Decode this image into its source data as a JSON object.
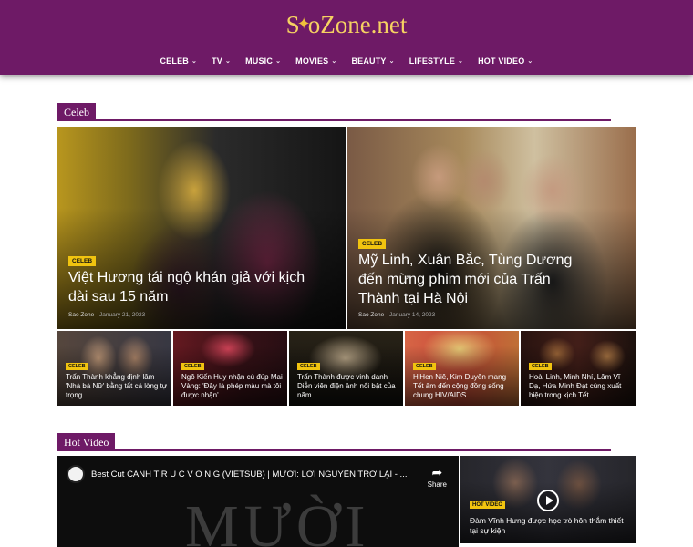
{
  "site": {
    "logo_part1": "S",
    "logo_part2": "oZone.net",
    "logo_star": "✦"
  },
  "nav": [
    {
      "label": "CELEB"
    },
    {
      "label": "TV"
    },
    {
      "label": "MUSIC"
    },
    {
      "label": "MOVIES"
    },
    {
      "label": "BEAUTY"
    },
    {
      "label": "LIFESTYLE"
    },
    {
      "label": "HOT VIDEO"
    }
  ],
  "sections": {
    "celeb": "Celeb",
    "hot_video": "Hot Video"
  },
  "featured": [
    {
      "category": "CELEB",
      "title": "Việt Hương tái ngộ khán giả với kịch dài sau 15 năm",
      "author": "Sao Zone",
      "date": "January 21, 2023"
    },
    {
      "category": "CELEB",
      "title": "Mỹ Linh, Xuân Bắc, Tùng Dương đến mừng phim mới của Trấn Thành tại Hà Nội",
      "author": "Sao Zone",
      "date": "January 14, 2023"
    }
  ],
  "small_posts": [
    {
      "category": "CELEB",
      "title": "Trấn Thành khẳng định lâm 'Nhà bà Nữ' bằng tất cả lòng tự trọng"
    },
    {
      "category": "CELEB",
      "title": "Ngô Kiến Huy nhận cú đúp Mai Vàng: 'Đây là phép màu mà tôi được nhận'"
    },
    {
      "category": "CELEB",
      "title": "Trấn Thành được vinh danh Diễn viên điện ảnh nổi bật của năm"
    },
    {
      "category": "CELEB",
      "title": "H'Hen Niê, Kim Duyên mang Tết ấm đến cộng đồng sống chung HIV/AIDS"
    },
    {
      "category": "CELEB",
      "title": "Hoài Linh, Minh Nhí, Lâm Vĩ Dạ, Hứa Minh Đạt cùng xuất hiện trong kịch Tết"
    }
  ],
  "video_main": {
    "title": "Best Cut CẢNH T R Ú C V O N G (VIETSUB) | MƯỜI: LỜI NGUYỀN TRỞ LẠI - ...",
    "share_label": "Share",
    "poster_word": "MƯỜI"
  },
  "video_side": {
    "category": "HOT VIDEO",
    "title": "Đàm Vĩnh Hưng được học trò hôn thắm thiết tại sự kiện"
  },
  "colors": {
    "brand": "#6e1a66",
    "badge": "#f1c40f",
    "logo": "#f6d262"
  }
}
